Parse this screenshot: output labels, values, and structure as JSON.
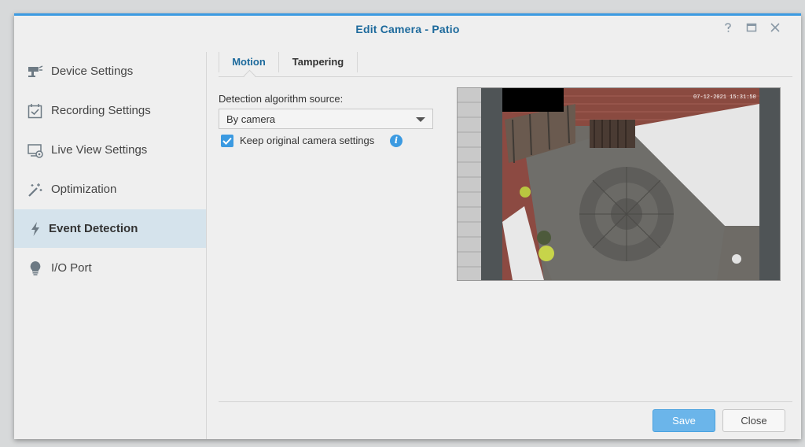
{
  "window": {
    "title": "Edit Camera - Patio",
    "help_icon": "help-icon",
    "maximize_icon": "maximize-icon",
    "close_icon": "close-icon"
  },
  "sidebar": {
    "items": [
      {
        "label": "Device Settings",
        "icon": "camera-device-icon"
      },
      {
        "label": "Recording Settings",
        "icon": "calendar-check-icon"
      },
      {
        "label": "Live View Settings",
        "icon": "monitor-icon"
      },
      {
        "label": "Optimization",
        "icon": "magic-wand-icon"
      },
      {
        "label": "Event Detection",
        "icon": "lightning-icon",
        "active": true
      },
      {
        "label": "I/O Port",
        "icon": "lightbulb-icon"
      }
    ]
  },
  "tabs": [
    {
      "label": "Motion",
      "active": true
    },
    {
      "label": "Tampering"
    }
  ],
  "motion": {
    "source_label": "Detection algorithm source:",
    "source_value": "By camera",
    "keep_settings_label": "Keep original camera settings",
    "keep_settings_checked": true,
    "preview_timestamp": "07-12-2021 15:31:50"
  },
  "footer": {
    "save_label": "Save",
    "close_label": "Close"
  },
  "colors": {
    "accent": "#3b9ae1",
    "title": "#1d6a9c",
    "active_nav_bg": "#d5e3ec"
  }
}
